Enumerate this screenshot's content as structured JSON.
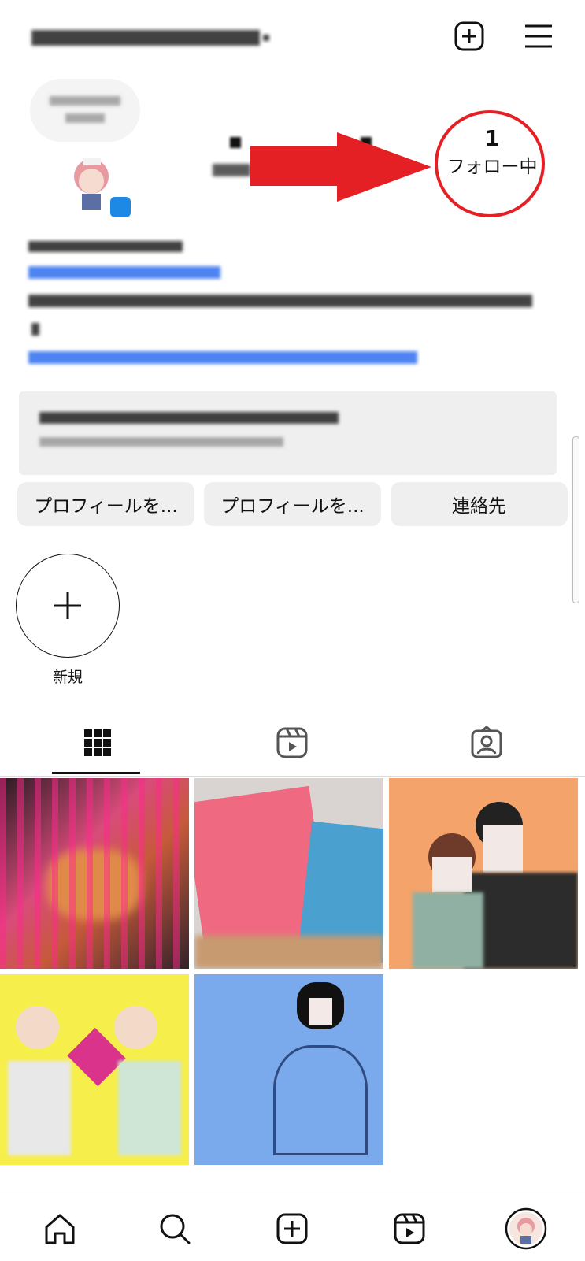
{
  "header": {
    "username": "",
    "create_label": "",
    "menu_label": ""
  },
  "profile": {
    "following_count": "1",
    "following_label": "フォロー中"
  },
  "actions": [
    {
      "label": "プロフィールを..."
    },
    {
      "label": "プロフィールを..."
    },
    {
      "label": "連絡先"
    }
  ],
  "highlights": {
    "new_label": "新規"
  },
  "tabs": [
    {
      "name": "grid"
    },
    {
      "name": "reels"
    },
    {
      "name": "tagged"
    }
  ],
  "bottom_nav": [
    {
      "name": "home-icon"
    },
    {
      "name": "search-icon"
    },
    {
      "name": "create-icon"
    },
    {
      "name": "reels-icon"
    },
    {
      "name": "profile-avatar"
    }
  ],
  "colors": {
    "annotation_red": "#e52025",
    "link_blue": "#2f6ff0",
    "verified_blue": "#1e88e5"
  }
}
